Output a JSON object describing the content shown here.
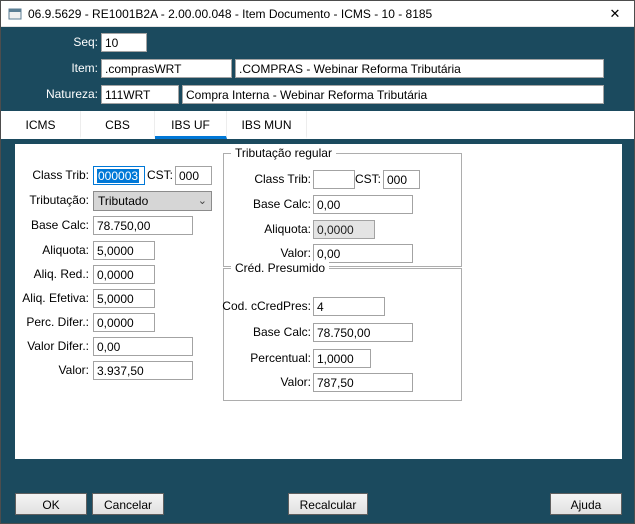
{
  "window": {
    "title": "06.9.5629 - RE1001B2A - 2.00.00.048 - Item Documento - ICMS - 10 - 8185",
    "close_label": "✕"
  },
  "header": {
    "seq_label": "Seq:",
    "seq_value": "10",
    "item_label": "Item:",
    "item_value": ".comprasWRT",
    "item_desc": ".COMPRAS - Webinar Reforma Tributária",
    "natureza_label": "Natureza:",
    "natureza_value": "111WRT",
    "natureza_desc": "Compra Interna - Webinar Reforma Tributária"
  },
  "tabs": [
    {
      "label": "ICMS"
    },
    {
      "label": "CBS"
    },
    {
      "label": "IBS UF"
    },
    {
      "label": "IBS MUN"
    }
  ],
  "active_tab": "IBS UF",
  "main": {
    "class_trib_label": "Class Trib:",
    "class_trib_value": "000003",
    "cst_label": "CST:",
    "cst_value": "000",
    "tributacao_label": "Tributação:",
    "tributacao_value": "Tributado",
    "base_calc_label": "Base Calc:",
    "base_calc_value": "78.750,00",
    "aliquota_label": "Aliquota:",
    "aliquota_value": "5,0000",
    "aliq_red_label": "Aliq. Red.:",
    "aliq_red_value": "0,0000",
    "aliq_efetiva_label": "Aliq. Efetiva:",
    "aliq_efetiva_value": "5,0000",
    "perc_difer_label": "Perc. Difer.:",
    "perc_difer_value": "0,0000",
    "valor_difer_label": "Valor Difer.:",
    "valor_difer_value": "0,00",
    "valor_label": "Valor:",
    "valor_value": "3.937,50"
  },
  "trib_regular": {
    "title": "Tributação regular",
    "class_trib_label": "Class Trib:",
    "class_trib_value": "",
    "cst_label": "CST:",
    "cst_value": "000",
    "base_calc_label": "Base Calc:",
    "base_calc_value": "0,00",
    "aliquota_label": "Aliquota:",
    "aliquota_value": "0,0000",
    "valor_label": "Valor:",
    "valor_value": "0,00"
  },
  "cred_presumido": {
    "title": "Créd. Presumido",
    "cod_label": "Cod. cCredPres:",
    "cod_value": "4",
    "base_calc_label": "Base Calc:",
    "base_calc_value": "78.750,00",
    "percentual_label": "Percentual:",
    "percentual_value": "1,0000",
    "valor_label": "Valor:",
    "valor_value": "787,50"
  },
  "buttons": {
    "ok": "OK",
    "cancelar": "Cancelar",
    "recalcular": "Recalcular",
    "ajuda": "Ajuda"
  },
  "colors": {
    "teal_bg": "#1b4a5e",
    "accent_blue": "#0078d7"
  }
}
